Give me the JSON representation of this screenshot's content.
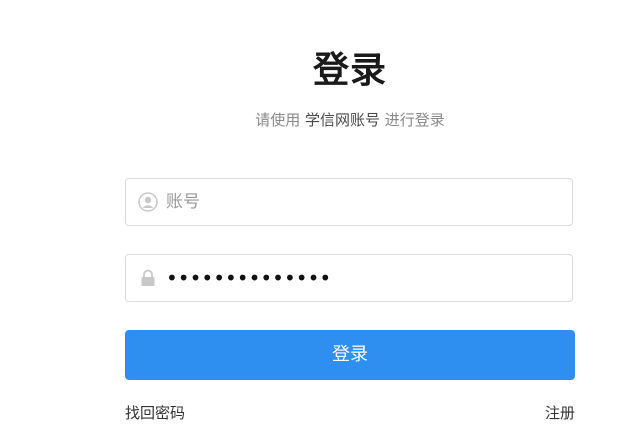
{
  "header": {
    "title": "登录",
    "subtitle_prefix": "请使用",
    "subtitle_account": "学信网账号",
    "subtitle_suffix": "进行登录"
  },
  "form": {
    "username": {
      "placeholder": "账号",
      "value": "",
      "icon": "user-icon"
    },
    "password": {
      "placeholder": "",
      "value": "••••••••••••••",
      "icon": "lock-icon"
    },
    "login_label": "登录"
  },
  "links": {
    "forgot_password": "找回密码",
    "register": "注册"
  },
  "colors": {
    "primary": "#2e8ff0",
    "title": "#1a1a1a",
    "muted": "#8a8a8a",
    "border": "#dcdcdc"
  }
}
